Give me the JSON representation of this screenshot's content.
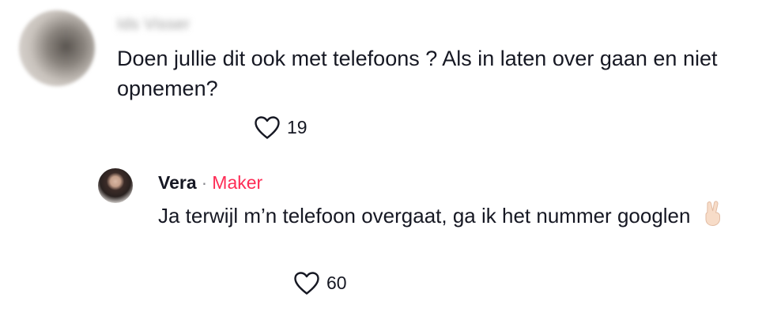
{
  "comment": {
    "username": "Ids Visser",
    "text": "Doen jullie dit ook met telefoons ? Als in laten over gaan en niet opnemen?",
    "likes": "19"
  },
  "reply": {
    "username": "Vera",
    "separator": "·",
    "badge": "Maker",
    "text": "Ja terwijl m’n telefoon overgaat, ga ik het nummer googlen",
    "emoji": "victory-hand",
    "likes": "60"
  },
  "colors": {
    "text": "#161823",
    "badge": "#fe2c55",
    "muted": "#8a8b91"
  }
}
